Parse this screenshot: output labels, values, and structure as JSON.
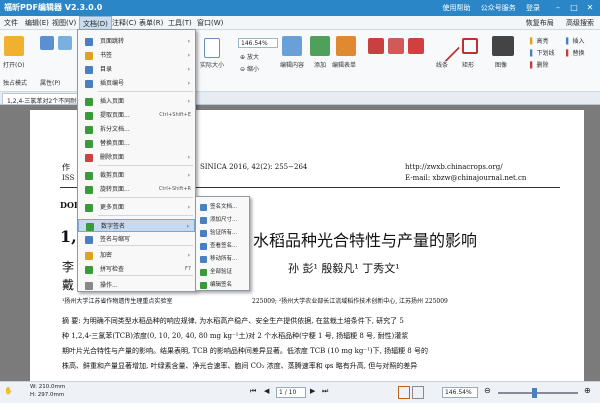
{
  "app": {
    "title": "福昕PDF编辑器 V2.3.0.0",
    "help_link": "使用帮助",
    "official_link": "公众号服务",
    "login": "登录"
  },
  "menubar": {
    "items": [
      "文件",
      "编辑(E)",
      "视图(V)",
      "文档(D)",
      "注释(C)",
      "表单(R)",
      "工具(T)",
      "窗口(W)"
    ],
    "right_items": [
      "恢复布局",
      "高级搜索"
    ]
  },
  "toolbar": {
    "open_label": "打开(O)",
    "single_page": "独占模式",
    "properties": "属性(P)",
    "actual_size": "实际大小",
    "zoom_value": "146.54%",
    "zoom_in": "放大",
    "zoom_out": "缩小",
    "edit_content": "编辑内容",
    "add": "添加",
    "edit_form": "编辑表单",
    "line": "线条",
    "rect": "矩形",
    "image": "图像",
    "highlight": "高亮",
    "underline": "下划线",
    "strike": "删除",
    "insert_text": "插入",
    "replace": "替换"
  },
  "tab": {
    "label": "1,2,4-三氯苯对2个不同耐热..."
  },
  "dropdown": {
    "items": [
      {
        "label": "页面跳转",
        "arrow": true,
        "color": "#4a7fc0"
      },
      {
        "label": "书签",
        "arrow": true,
        "color": "#e0a020"
      },
      {
        "label": "目录",
        "arrow": true,
        "color": "#4a7fc0"
      },
      {
        "label": "插页编号",
        "arrow": true,
        "color": "#4a7fc0"
      },
      {
        "label": "插入页面",
        "arrow": true,
        "color": "#3a9a3a"
      },
      {
        "label": "提取页面...",
        "shortcut": "Ctrl+Shift+E",
        "color": "#3a9a3a"
      },
      {
        "label": "拆分文档...",
        "color": "#3a9a3a"
      },
      {
        "label": "替换页面...",
        "color": "#3a9a3a"
      },
      {
        "label": "删除页面",
        "arrow": true,
        "color": "#d04040"
      },
      {
        "label": "裁剪页面",
        "arrow": true,
        "color": "#3a9a3a"
      },
      {
        "label": "旋转页面...",
        "shortcut": "Ctrl+Shift+R",
        "color": "#3a9a3a"
      },
      {
        "label": "更多页面",
        "arrow": true,
        "color": "#3a9a3a"
      },
      {
        "label": "数字签名",
        "arrow": true,
        "color": "#3a9a3a",
        "highlighted": true
      },
      {
        "label": "签名与缩写",
        "color": "#4a7fc0"
      },
      {
        "label": "加密",
        "arrow": true,
        "color": "#e0a020"
      },
      {
        "label": "拼写检查",
        "shortcut": "F7",
        "color": "#3a9a3a"
      },
      {
        "label": "操作...",
        "color": "#888888"
      }
    ]
  },
  "submenu": {
    "items": [
      {
        "label": "签名文档...",
        "color": "#4a7fc0"
      },
      {
        "label": "添加尺寸...",
        "color": "#4a7fc0"
      },
      {
        "label": "验证所有...",
        "color": "#4a7fc0"
      },
      {
        "label": "查看签名...",
        "color": "#4a7fc0"
      },
      {
        "label": "移动所有...",
        "color": "#4a7fc0"
      },
      {
        "label": "全部验证",
        "color": "#3a9a3a"
      },
      {
        "label": "编辑签名",
        "color": "#3a9a3a"
      }
    ]
  },
  "document": {
    "header_left": "作物学报 ACTA AGRONOMICA SINICA 2016, 42(2): 255−264",
    "header_left_short": "作",
    "issn": "ISS",
    "journal_code": "SINICA  2016, 42(2): 255−264",
    "url": "http://zwxb.chinacrops.org/",
    "email": "E-mail: xbzw@chinajournal.net.cn",
    "doi": "DOI",
    "title_start": "1,2",
    "title_rest": "水稻品种光合特性与产量的影响",
    "authors": "孙  彭¹    殷毅凡¹    丁秀文¹",
    "authors_left": "李",
    "authors_left2": "戴",
    "affiliation": "225009; ²扬州大学农业部长江流域稻作技术创新中心, 江苏扬州 225009",
    "affiliation_left": "¹扬州大学江苏省作物遗传生理重点实验室",
    "abstract_1": "摘  要: 为明确不同类型水稻品种的响应规律, 为水稻高产稳产、安全生产提供依据, 在盆栽土培条件下, 研究了 5",
    "abstract_2": "种 1,2,4-三氯苯(TCB)浓度(0, 10, 20, 40, 80 mg kg⁻¹土)对 2 个水稻品种(宁粳 1 号, 扬辐粳 8 号, 耐性)灌浆",
    "abstract_3": "期叶片光合特性与产量的影响。结果表明, TCB 的影响品种间差异显著。低浓度 TCB (10 mg kg⁻¹)下, 扬辐粳 8 号的",
    "abstract_4": "株高、鲜重和产量显著增加, 叶绿素含量、净光合速率、胞间 CO₂ 浓度、蒸腾速率和 φs 略有升高, 但与对照的差异"
  },
  "statusbar": {
    "page_size": "W: 210.0mm",
    "page_size_h": "H: 297.0mm",
    "page_current": "1",
    "page_total": "/ 10",
    "zoom": "146.54%"
  }
}
